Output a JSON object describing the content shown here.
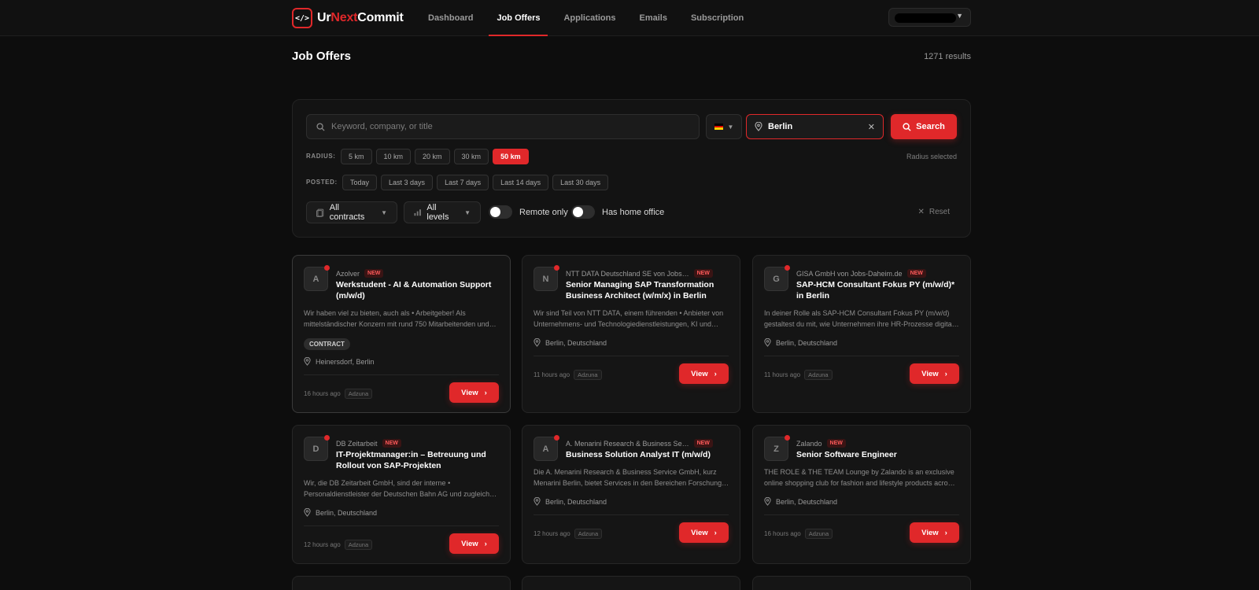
{
  "app": {
    "brand_prefix": "Ur",
    "brand_accent": "Next",
    "brand_suffix": "Commit",
    "logo_glyph": "</>",
    "accent_color": "#e0282a"
  },
  "nav": {
    "items": [
      {
        "label": "Dashboard"
      },
      {
        "label": "Job Offers"
      },
      {
        "label": "Applications"
      },
      {
        "label": "Emails"
      },
      {
        "label": "Subscription"
      }
    ],
    "active": "Job Offers"
  },
  "page": {
    "title": "Job Offers",
    "results": "1271 results"
  },
  "filters": {
    "search_placeholder": "Keyword, company, or title",
    "location_value": "Berlin",
    "search_label": "Search",
    "radius_label": "RADIUS:",
    "radius_options": [
      "5 km",
      "10 km",
      "20 km",
      "30 km",
      "50 km"
    ],
    "radius_selected": "50 km",
    "radius_hint": "Radius selected",
    "posted_label": "POSTED:",
    "posted_options": [
      "Today",
      "Last 3 days",
      "Last 7 days",
      "Last 14 days",
      "Last 30 days"
    ],
    "contracts_label": "All contracts",
    "levels_label": "All levels",
    "remote_label": "Remote only",
    "home_office_label": "Has home office",
    "reset_label": "Reset"
  },
  "jobs": [
    {
      "initial": "A",
      "company": "Azolver",
      "badge": "NEW",
      "title": "Werkstudent - AI & Automation Support (m/w/d)",
      "desc": "Wir haben viel zu bieten, auch als • Arbeitgeber! Als mittelständischer Konzern mit rund 750 Mitarbeitenden und…",
      "tag": "CONTRACT",
      "location": "Heinersdorf, Berlin",
      "posted": "16 hours ago",
      "source": "Adzuna",
      "view": "View"
    },
    {
      "initial": "N",
      "company": "NTT DATA Deutschland SE von Jobs…",
      "badge": "NEW",
      "title": "Senior Managing SAP Transformation Business Architect (w/m/x) in Berlin",
      "desc": "Wir sind Teil von NTT DATA, einem führenden • Anbieter von Unternehmens- und Technologiedienstleistungen, KI und…",
      "tag": "",
      "location": "Berlin, Deutschland",
      "posted": "11 hours ago",
      "source": "Adzuna",
      "view": "View"
    },
    {
      "initial": "G",
      "company": "GISA GmbH von Jobs-Daheim.de",
      "badge": "NEW",
      "title": "SAP-HCM Consultant Fokus PY (m/w/d)* in Berlin",
      "desc": "In deiner Rolle als SAP-HCM Consultant Fokus PY (m/w/d) gestaltest du mit, wie Unternehmen ihre HR-Prozesse digita…",
      "tag": "",
      "location": "Berlin, Deutschland",
      "posted": "11 hours ago",
      "source": "Adzuna",
      "view": "View"
    },
    {
      "initial": "D",
      "company": "DB Zeitarbeit",
      "badge": "NEW",
      "title": "IT-Projektmanager:in – Betreuung und Rollout von SAP-Projekten",
      "desc": "Wir, die DB Zeitarbeit GmbH, sind der interne • Personaldienstleister der Deutschen Bahn AG und zugleich…",
      "tag": "",
      "location": "Berlin, Deutschland",
      "posted": "12 hours ago",
      "source": "Adzuna",
      "view": "View"
    },
    {
      "initial": "A",
      "company": "A. Menarini Research & Business Se…",
      "badge": "NEW",
      "title": "Business Solution Analyst IT (m/w/d)",
      "desc": "Die A. Menarini Research & Business Service GmbH, kurz Menarini Berlin, bietet Services in den Bereichen Forschung…",
      "tag": "",
      "location": "Berlin, Deutschland",
      "posted": "12 hours ago",
      "source": "Adzuna",
      "view": "View"
    },
    {
      "initial": "Z",
      "company": "Zalando",
      "badge": "NEW",
      "title": "Senior Software Engineer",
      "desc": "THE ROLE & THE TEAM Lounge by Zalando is an exclusive online shopping club for fashion and lifestyle products acro…",
      "tag": "",
      "location": "Berlin, Deutschland",
      "posted": "16 hours ago",
      "source": "Adzuna",
      "view": "View"
    }
  ]
}
